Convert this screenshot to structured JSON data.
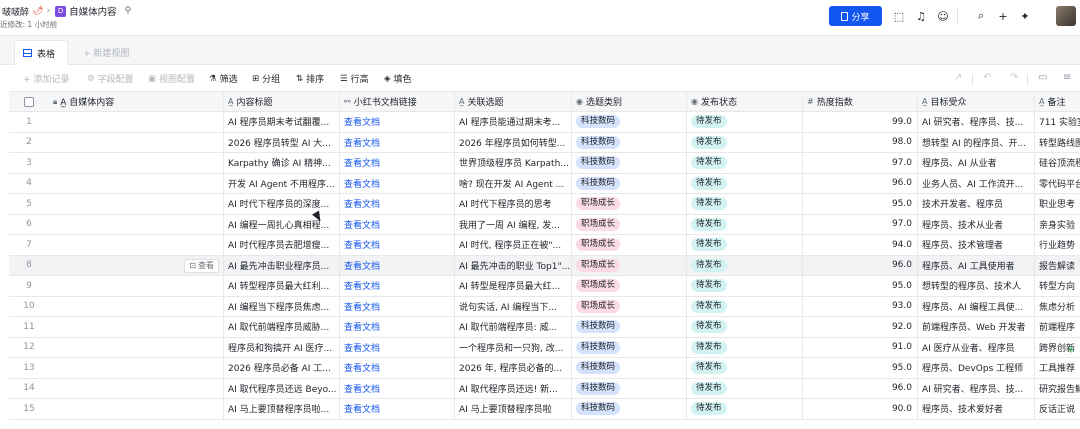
{
  "topbar": {
    "breadcrumb_user": "啵啵醉",
    "breadcrumb_emoji": "🌶",
    "breadcrumb_sep": "›",
    "doc_icon": "D",
    "doc_title": "自媒体内容",
    "modified": "近修改: 1 小时前",
    "share_label": "分享",
    "icons": [
      "export-icon",
      "bell-icon",
      "smile-icon",
      "search-icon",
      "plus-icon",
      "sparkle-icon"
    ],
    "accent": "#1456f0"
  },
  "tabs": {
    "active_label": "表格",
    "add_label": "+ 新建视图"
  },
  "toolbar": {
    "add_record": "+ 添加记录",
    "field_config": "字段配置",
    "view_config": "视图配置",
    "filter": "筛选",
    "group": "分组",
    "sort": "排序",
    "row_height": "行高",
    "fill_color": "填色"
  },
  "table": {
    "columns": [
      {
        "icon": "lock-icon",
        "label": "A̲ 自媒体内容"
      },
      {
        "icon": "text-icon",
        "label": "内容标题"
      },
      {
        "icon": "link-icon",
        "label": "小红书文档链接"
      },
      {
        "icon": "text-icon",
        "label": "关联选题"
      },
      {
        "icon": "select-icon",
        "label": "选题类别"
      },
      {
        "icon": "select-icon",
        "label": "发布状态"
      },
      {
        "icon": "hash-icon",
        "label": "热度指数"
      },
      {
        "icon": "text-icon",
        "label": "目标受众"
      },
      {
        "icon": "text-icon",
        "label": "备注"
      }
    ],
    "view_button": "查看",
    "rows": [
      {
        "n": "1",
        "title": "AI 程序员期末考试翻覆...",
        "link": "查看文档",
        "topic": "AI 程序员能通过期末考...",
        "cat": "科技数码",
        "catColor": "blue",
        "status": "待发布",
        "heat": "99.0",
        "audience": "AI 研究者、程序员、技...",
        "note": "711 实验室"
      },
      {
        "n": "2",
        "title": "2026 程序员转型 AI 大...",
        "link": "查看文档",
        "topic": "2026 年程序员如何转型...",
        "cat": "科技数码",
        "catColor": "blue",
        "status": "待发布",
        "heat": "98.0",
        "audience": "想转型 AI 的程序员、开...",
        "note": "转型路线图"
      },
      {
        "n": "3",
        "title": "Karpathy 确诊 AI 精神...",
        "link": "查看文档",
        "topic": "世界顶级程序员 Karpath...",
        "cat": "科技数码",
        "catColor": "blue",
        "status": "待发布",
        "heat": "97.0",
        "audience": "程序员、AI 从业者",
        "note": "硅谷顶流程"
      },
      {
        "n": "4",
        "title": "开发 AI Agent 不用程序...",
        "link": "查看文档",
        "topic": "啥? 现在开发 AI Agent ...",
        "cat": "科技数码",
        "catColor": "blue",
        "status": "待发布",
        "heat": "96.0",
        "audience": "业务人员、AI 工作流开...",
        "note": "零代码平台"
      },
      {
        "n": "5",
        "title": "AI 时代下程序员的深度...",
        "link": "查看文档",
        "topic": "AI 时代下程序员的思考",
        "cat": "职场成长",
        "catColor": "pink",
        "status": "待发布",
        "heat": "95.0",
        "audience": "技术开发者、程序员",
        "note": "职业思考"
      },
      {
        "n": "6",
        "title": "AI 编程一周扎心真相程...",
        "link": "查看文档",
        "topic": "我用了一周 AI 编程, 发...",
        "cat": "职场成长",
        "catColor": "pink",
        "status": "待发布",
        "heat": "97.0",
        "audience": "程序员、技术从业者",
        "note": "亲身实验"
      },
      {
        "n": "7",
        "title": "AI 时代程序员去肥增瘦...",
        "link": "查看文档",
        "topic": "AI 时代, 程序员正在被\"...",
        "cat": "职场成长",
        "catColor": "pink",
        "status": "待发布",
        "heat": "94.0",
        "audience": "程序员、技术管理者",
        "note": "行业趋势"
      },
      {
        "n": "8",
        "title": "AI 最先冲击职业程序员...",
        "link": "查看文档",
        "topic": "AI 最先冲击的职业 Top1\"...",
        "cat": "职场成长",
        "catColor": "pink",
        "status": "待发布",
        "heat": "96.0",
        "audience": "程序员、AI 工具使用者",
        "note": "报告解读"
      },
      {
        "n": "9",
        "title": "AI 转型程序员最大红利...",
        "link": "查看文档",
        "topic": "AI 转型是程序员最大红...",
        "cat": "职场成长",
        "catColor": "pink",
        "status": "待发布",
        "heat": "95.0",
        "audience": "想转型的程序员、技术人",
        "note": "转型方向"
      },
      {
        "n": "10",
        "title": "AI 编程当下程序员焦虑...",
        "link": "查看文档",
        "topic": "说句实话, AI 编程当下...",
        "cat": "职场成长",
        "catColor": "pink",
        "status": "待发布",
        "heat": "93.0",
        "audience": "程序员、AI 编程工具使...",
        "note": "焦虑分析"
      },
      {
        "n": "11",
        "title": "AI 取代前端程序员威胁...",
        "link": "查看文档",
        "topic": "AI 取代前端程序员: 威...",
        "cat": "科技数码",
        "catColor": "blue",
        "status": "待发布",
        "heat": "92.0",
        "audience": "前端程序员、Web 开发者",
        "note": "前端程序"
      },
      {
        "n": "12",
        "title": "程序员和狗搞开 AI 医疗...",
        "link": "查看文档",
        "topic": "一个程序员和一只狗, 改...",
        "cat": "科技数码",
        "catColor": "blue",
        "status": "待发布",
        "heat": "91.0",
        "audience": "AI 医疗从业者、程序员",
        "note": "跨界创新"
      },
      {
        "n": "13",
        "title": "2026 程序员必备 AI 工...",
        "link": "查看文档",
        "topic": "2026 年, 程序员必备的...",
        "cat": "科技数码",
        "catColor": "blue",
        "status": "待发布",
        "heat": "95.0",
        "audience": "程序员、DevOps 工程师",
        "note": "工具推荐"
      },
      {
        "n": "14",
        "title": "AI 取代程序员还远 Beyo...",
        "link": "查看文档",
        "topic": "AI 取代程序员还远! 新...",
        "cat": "科技数码",
        "catColor": "blue",
        "status": "待发布",
        "heat": "96.0",
        "audience": "AI 研究者、程序员、技...",
        "note": "研究报告解"
      },
      {
        "n": "15",
        "title": "AI 马上要顶替程序员啦...",
        "link": "查看文档",
        "topic": "AI 马上要顶替程序员啦",
        "cat": "科技数码",
        "catColor": "blue",
        "status": "待发布",
        "heat": "90.0",
        "audience": "程序员、技术爱好者",
        "note": "反话正说"
      }
    ]
  }
}
